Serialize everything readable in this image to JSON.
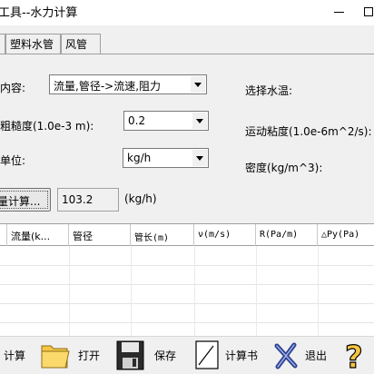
{
  "window": {
    "title": "工具--水力计算"
  },
  "tabs": [
    {
      "label": "塑料水管"
    },
    {
      "label": "风管"
    }
  ],
  "form": {
    "content_label": "内容:",
    "content_value": "流量,管径->流速,阻力",
    "roughness_label": "粗糙度(1.0e-3 m):",
    "roughness_value": "0.2",
    "unit_label": "单位:",
    "unit_value": "kg/h",
    "water_temp_label": "选择水温:",
    "viscosity_label": "运动粘度(1.0e-6m^2/s):",
    "density_label": "密度(kg/m^3):",
    "calc_flow_button": "量计算...",
    "result_value": "103.2",
    "result_unit": "(kg/h)"
  },
  "table": {
    "columns": [
      "流量(k...",
      "管径",
      "管长(m)",
      "ν(m/s)",
      "R(Pa/m)",
      "△Py(Pa)"
    ]
  },
  "toolbar": {
    "calc_label": "计算",
    "open_label": "打开",
    "save_label": "保存",
    "report_label": "计算书",
    "exit_label": "退出"
  },
  "colors": {
    "window_bg": "#f0f0f0",
    "folder_yellow": "#f5c542",
    "exit_blue": "#2a3f8f"
  }
}
